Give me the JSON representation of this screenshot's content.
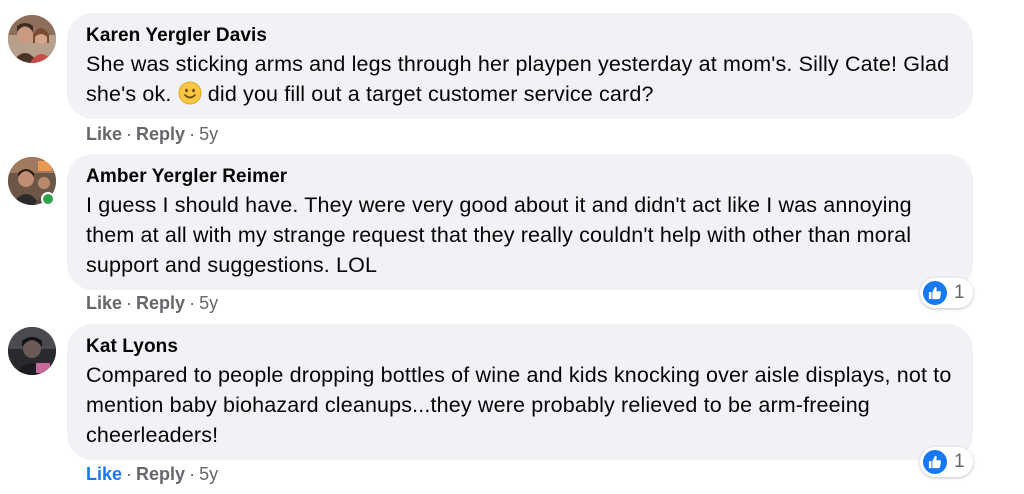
{
  "colors": {
    "bubble": "#f0f2f5",
    "meta": "#65676b",
    "like_blue": "#1877f2",
    "online_green": "#31a24c"
  },
  "comments": [
    {
      "author": "Karen Yergler Davis",
      "text_before_emoji": "She was sticking arms and legs through her playpen yesterday at mom's. Silly Cate! Glad she's ok.",
      "emoji": "slightly-smiling-face",
      "text_after_emoji": "did you fill out a target customer service card?",
      "like_label": "Like",
      "reply_label": "Reply",
      "time": "5y",
      "online": false
    },
    {
      "author": "Amber Yergler Reimer",
      "text": "I guess I should have. They were very good about it and didn't act like I was annoying them at all with my strange request that they really couldn't help with other than moral support and suggestions. LOL",
      "like_label": "Like",
      "reply_label": "Reply",
      "time": "5y",
      "online": true,
      "reaction": {
        "icon": "like-icon",
        "count": "1"
      }
    },
    {
      "author": "Kat Lyons",
      "text": "Compared to people dropping bottles of wine and kids knocking over aisle displays, not to mention baby biohazard cleanups...they were probably relieved to be arm-freeing cheerleaders!",
      "like_label": "Like",
      "reply_label": "Reply",
      "time": "5y",
      "online": false,
      "liked": true,
      "reaction": {
        "icon": "like-icon",
        "count": "1"
      }
    }
  ],
  "separator": "·"
}
